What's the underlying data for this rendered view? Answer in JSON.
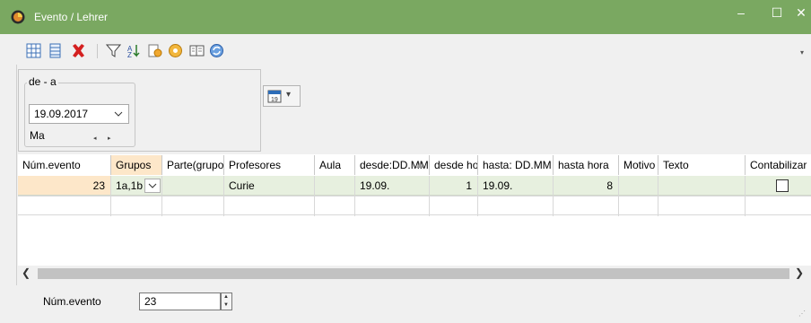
{
  "window": {
    "title": "Evento / Lehrer",
    "minimize_glyph": "‒",
    "maximize_glyph": "☐",
    "close_glyph": "✕",
    "accent": "#7aa861"
  },
  "toolbar": {
    "icons": [
      "add-row-icon",
      "list-icon",
      "delete-icon",
      "filter-icon",
      "sort-icon",
      "print-settings-icon",
      "settings-gear-icon",
      "sheet-icon",
      "refresh-icon"
    ],
    "more_glyph": "▾"
  },
  "date_panel": {
    "group_title": "de - a",
    "date_value": "19.09.2017",
    "day_label": "Ma",
    "spin_left": "◂",
    "spin_right": "▸"
  },
  "calendar_button": {
    "icon": "calendar-icon",
    "glyph": "▾"
  },
  "table": {
    "columns": [
      "Núm.evento",
      "Grupos",
      "Parte(grupos)",
      "Profesores",
      "Aula",
      "desde:DD.MM",
      "desde hora",
      "hasta: DD.MM",
      "hasta hora",
      "Motivo",
      "Texto",
      "Contabilizar"
    ],
    "rows": [
      {
        "num_evento": "23",
        "grupos": "1a,1b",
        "parte": "",
        "profesores": "Curie",
        "aula": "",
        "desde_dd": "19.09.",
        "desde_hora": "1",
        "hasta_dd": "19.09.",
        "hasta_hora": "8",
        "motivo": "",
        "texto": "",
        "contabilizar": false
      }
    ],
    "highlight_color": "#fde7c9",
    "selected_row_color": "#e7f0df"
  },
  "scrollbar": {
    "left_glyph": "❮",
    "right_glyph": "❯"
  },
  "footer": {
    "label": "Núm.evento",
    "value": "23",
    "spin_up": "▲",
    "spin_down": "▼",
    "grip": "⋰"
  }
}
